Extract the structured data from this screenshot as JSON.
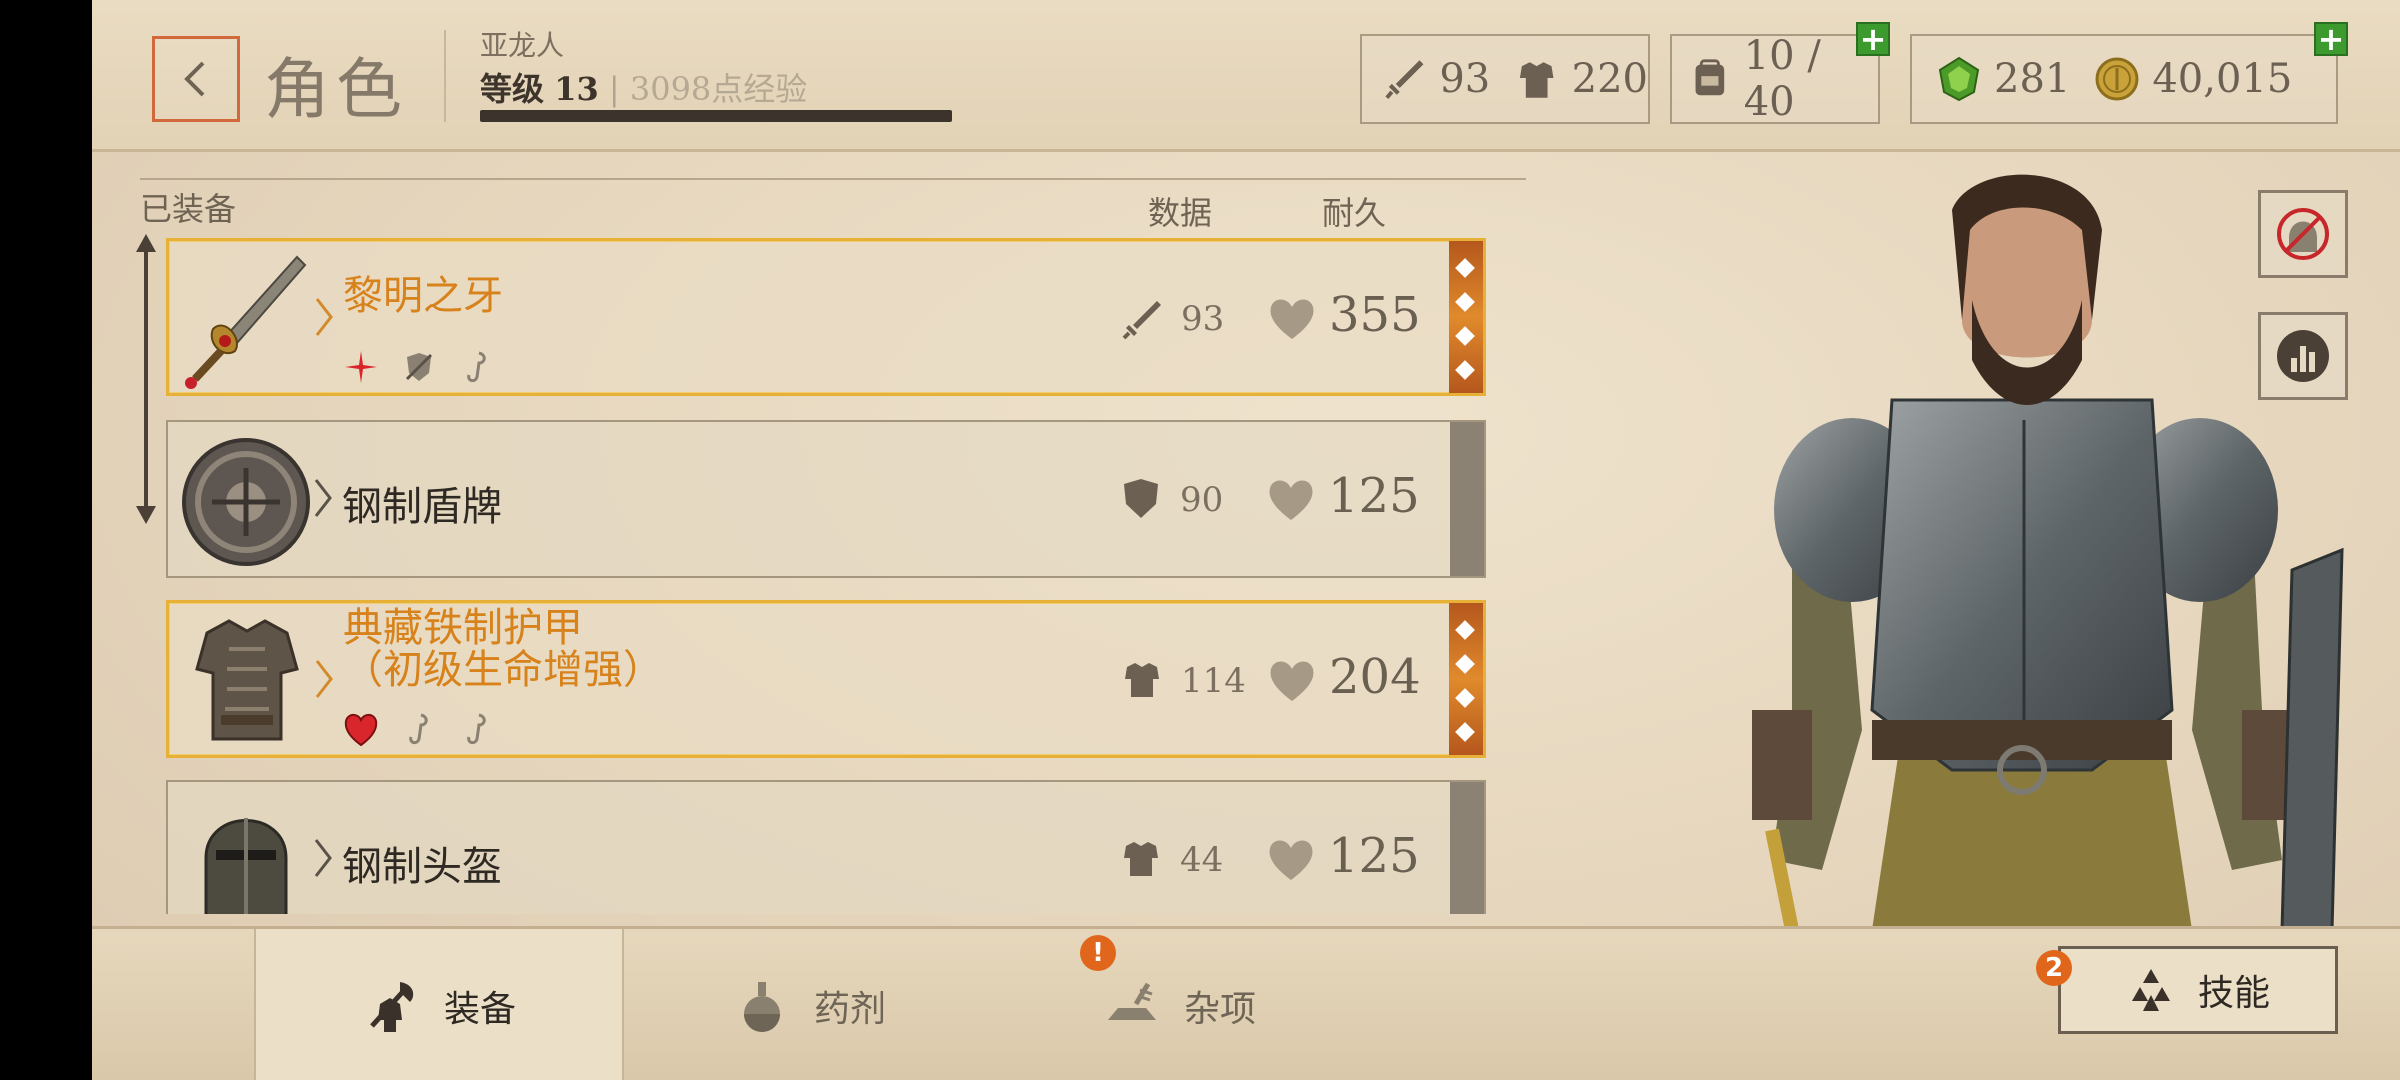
{
  "header": {
    "title": "角色",
    "race": "亚龙人",
    "level_label": "等级",
    "level": "13",
    "xp_text": "3098点经验",
    "xp_progress": 1.0
  },
  "stats": {
    "attack": "93",
    "armor": "220",
    "inventory": "10 / 40",
    "gems": "281",
    "gold": "40,015"
  },
  "list": {
    "equipped_label": "已装备",
    "col_data": "数据",
    "col_durability": "耐久",
    "items": [
      {
        "name_line1": "黎明之牙",
        "name_line2": "",
        "stat_icon": "sword-icon",
        "stat": "93",
        "durability": "355",
        "quality": "gold",
        "badges": [
          "red-star-icon",
          "shield-break-icon",
          "hook-icon"
        ]
      },
      {
        "name_line1": "钢制盾牌",
        "name_line2": "",
        "stat_icon": "shield-icon",
        "stat": "90",
        "durability": "125",
        "quality": "normal",
        "badges": []
      },
      {
        "name_line1": "典藏铁制护甲",
        "name_line2": "（初级生命增强）",
        "stat_icon": "armor-icon",
        "stat": "114",
        "durability": "204",
        "quality": "gold",
        "badges": [
          "heart-icon",
          "hook-icon",
          "hook-icon"
        ]
      },
      {
        "name_line1": "钢制头盔",
        "name_line2": "",
        "stat_icon": "armor-icon",
        "stat": "44",
        "durability": "125",
        "quality": "normal",
        "badges": []
      }
    ]
  },
  "tabs": [
    {
      "label": "装备",
      "icon": "axe-armor-icon",
      "active": true
    },
    {
      "label": "药剂",
      "icon": "potion-icon",
      "active": false
    },
    {
      "label": "杂项",
      "icon": "ingot-icon",
      "active": false,
      "notification": "!"
    }
  ],
  "skills": {
    "label": "技能",
    "badge": "2"
  },
  "colors": {
    "accent_gold": "#e6b136",
    "accent_orange": "#d7821b",
    "plus_green": "#3d9a2e",
    "notif_orange": "#e0661c"
  }
}
